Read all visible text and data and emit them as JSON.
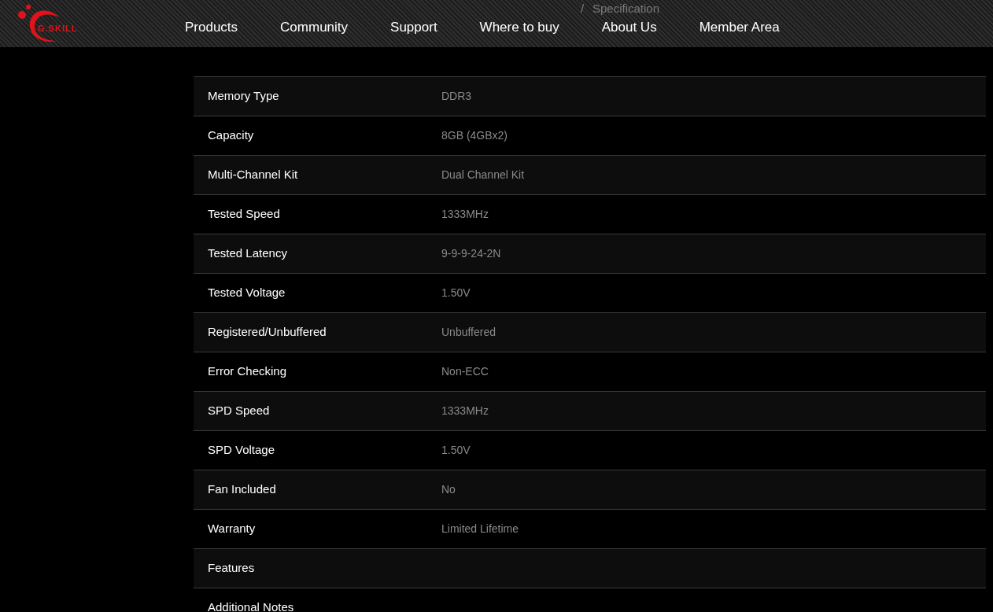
{
  "logo": {
    "text": "G.SKILL"
  },
  "nav": [
    {
      "label": "Products"
    },
    {
      "label": "Community"
    },
    {
      "label": "Support"
    },
    {
      "label": "Where to buy"
    },
    {
      "label": "About Us"
    },
    {
      "label": "Member Area"
    }
  ],
  "breadcrumb": {
    "separator": "/",
    "current": "Specification"
  },
  "spec_table": {
    "rows": [
      {
        "label": "Memory Type",
        "value": "DDR3"
      },
      {
        "label": "Capacity",
        "value": "8GB (4GBx2)"
      },
      {
        "label": "Multi-Channel Kit",
        "value": "Dual Channel Kit"
      },
      {
        "label": "Tested Speed",
        "value": "1333MHz"
      },
      {
        "label": "Tested Latency",
        "value": "9-9-9-24-2N"
      },
      {
        "label": "Tested Voltage",
        "value": "1.50V"
      },
      {
        "label": "Registered/Unbuffered",
        "value": "Unbuffered"
      },
      {
        "label": "Error Checking",
        "value": "Non-ECC"
      },
      {
        "label": "SPD Speed",
        "value": "1333MHz"
      },
      {
        "label": "SPD Voltage",
        "value": "1.50V"
      },
      {
        "label": "Fan Included",
        "value": "No"
      },
      {
        "label": "Warranty",
        "value": "Limited Lifetime"
      },
      {
        "label": "Features"
      },
      {
        "label": "Additional Notes"
      }
    ]
  }
}
